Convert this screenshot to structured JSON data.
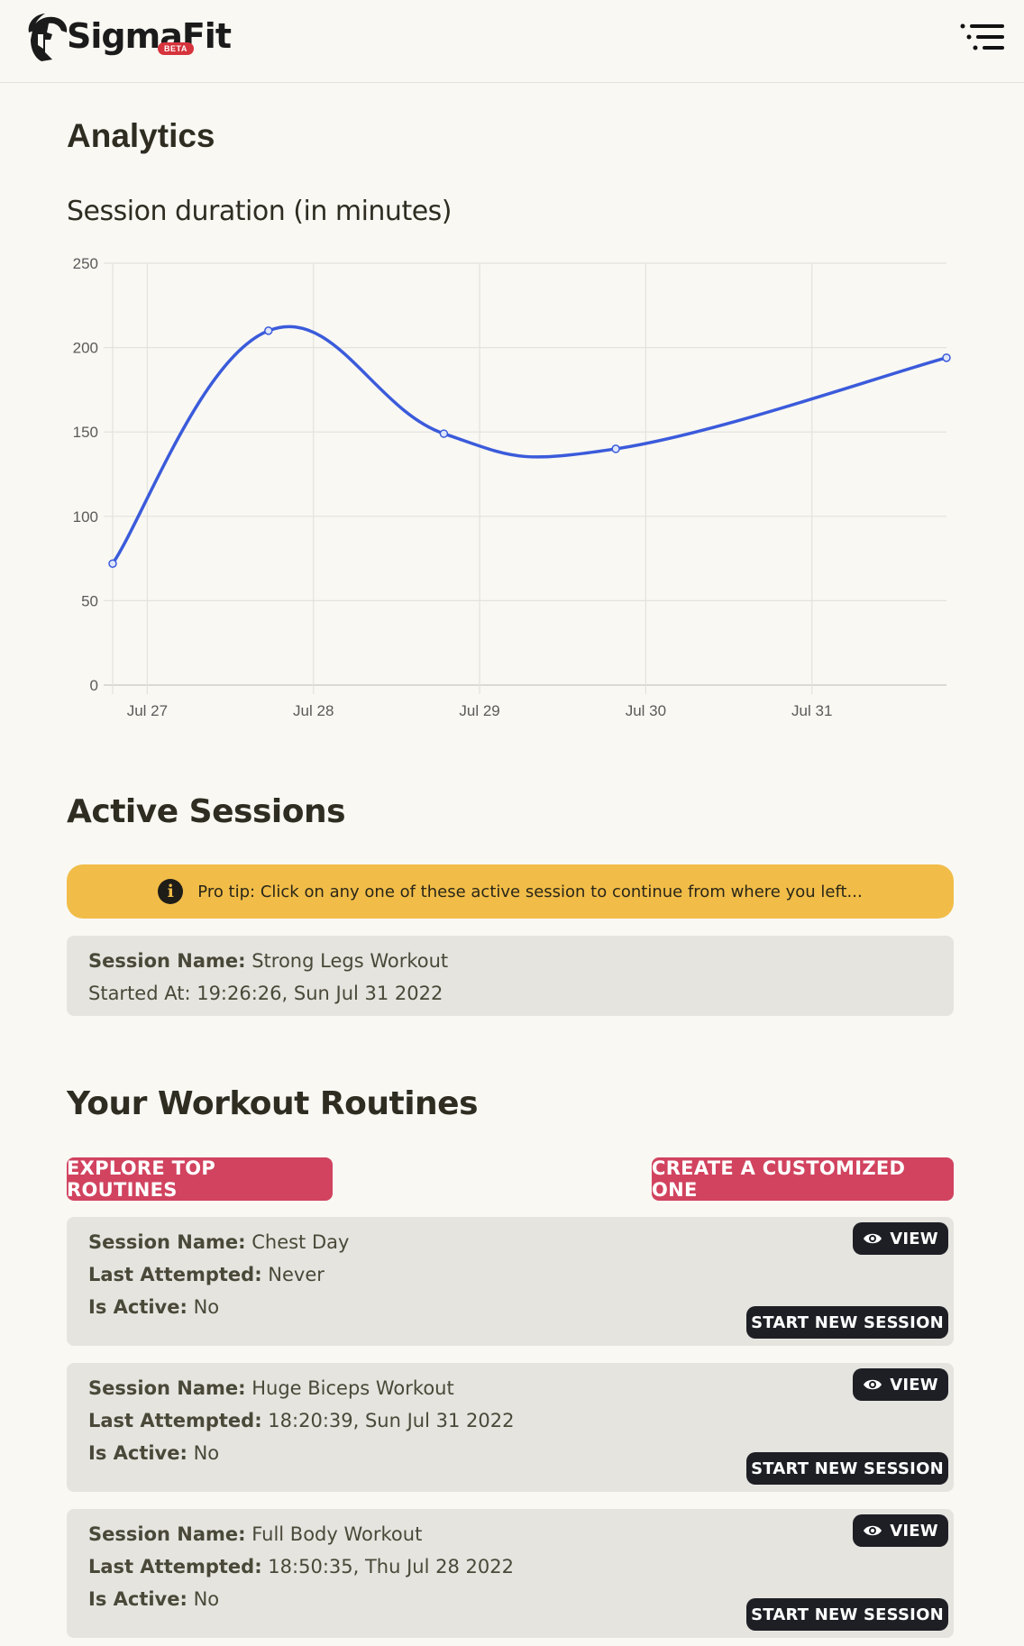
{
  "header": {
    "logo_text": "SigmaFit",
    "beta_label": "BETA",
    "menu_icon": "menu-lines-icon"
  },
  "page_title": "Analytics",
  "chart_title": "Session duration (in minutes)",
  "chart_data": {
    "type": "line",
    "title": "Session duration (in minutes)",
    "xlabel": "",
    "ylabel": "",
    "ylim": [
      0,
      250
    ],
    "y_ticks": [
      "0",
      "50",
      "100",
      "150",
      "200",
      "250"
    ],
    "x_ticks": [
      "Jul 27",
      "Jul 28",
      "Jul 29",
      "Jul 30",
      "Jul 31"
    ],
    "x_range": [
      "2022-07-26T19:00",
      "2022-07-31T19:26"
    ],
    "series": [
      {
        "x": [
          "2022-07-26T19:00",
          "2022-07-27T17:30",
          "2022-07-28T18:50",
          "2022-07-29T19:40",
          "2022-07-31T19:26"
        ],
        "values": [
          72,
          210,
          149,
          140,
          194
        ],
        "color": "#3b5bdb"
      }
    ],
    "grid": true
  },
  "active_sessions": {
    "heading": "Active Sessions",
    "tip": "Pro tip: Click on any one of these active session to continue from where you left...",
    "items": [
      {
        "name_key": "Session Name:",
        "name": "Strong Legs Workout",
        "started": "Started At: 19:26:26, Sun Jul 31 2022"
      }
    ]
  },
  "routines": {
    "heading": "Your Workout Routines",
    "explore_label": "EXPLORE TOP ROUTINES",
    "create_label": "CREATE A CUSTOMIZED ONE",
    "name_key": "Session Name:",
    "attempt_key": "Last Attempted:",
    "active_key": "Is Active:",
    "view_label": "VIEW",
    "start_label": "START NEW SESSION",
    "items": [
      {
        "name": "Chest Day",
        "last_attempted": "Never",
        "is_active": "No"
      },
      {
        "name": "Huge Biceps Workout",
        "last_attempted": "18:20:39, Sun Jul 31 2022",
        "is_active": "No"
      },
      {
        "name": "Full Body Workout",
        "last_attempted": "18:50:35, Thu Jul 28 2022",
        "is_active": "No"
      }
    ]
  }
}
